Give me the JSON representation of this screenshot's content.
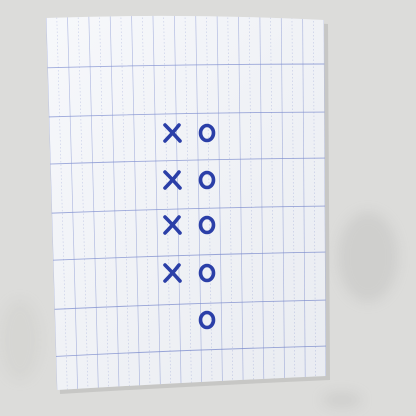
{
  "paper": {
    "color": "#f4f6fa",
    "rule_color": "#5b6fc4",
    "dot_rule_color": "#9aa6d8"
  },
  "ink": {
    "color": "#2b3fa8"
  },
  "marks": {
    "x_column": [
      {
        "symbol": "x",
        "row": 1
      },
      {
        "symbol": "x",
        "row": 2
      },
      {
        "symbol": "x",
        "row": 3
      },
      {
        "symbol": "x",
        "row": 4
      }
    ],
    "o_column": [
      {
        "symbol": "o",
        "row": 1
      },
      {
        "symbol": "o",
        "row": 2
      },
      {
        "symbol": "o",
        "row": 3
      },
      {
        "symbol": "o",
        "row": 4
      },
      {
        "symbol": "o",
        "row": 5
      }
    ]
  },
  "background": {
    "surface_color": "#dcdcda"
  }
}
